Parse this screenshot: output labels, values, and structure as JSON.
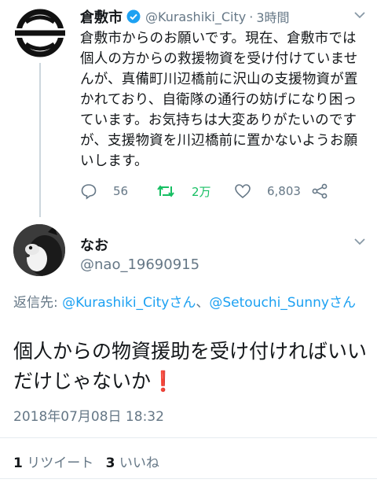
{
  "tweet": {
    "display_name": "倉敷市",
    "handle": "@Kurashiki_City",
    "separator": "·",
    "time": "3時間",
    "text": "倉敷市からのお願いです。現在、倉敷市では個人の方からの救援物資を受け付けていませんが、真備町川辺橋前に沢山の支援物資が置かれており、自衛隊の通行の妨げになり困っています。お気持ちは大変ありがたいのですが、支援物資を川辺橋前に置かないようお願いします。",
    "actions": {
      "reply_count": "56",
      "retweet_count": "2万",
      "like_count": "6,803"
    }
  },
  "reply": {
    "display_name": "なお",
    "handle": "@nao_19690915",
    "reply_to_label": "返信先: ",
    "reply_to_user1": "@Kurashiki_Cityさん",
    "reply_to_sep": "、",
    "reply_to_user2": "@Setouchi_Sunnyさん",
    "text": "個人からの物資援助を受け付ければいいだけじゃないか",
    "emoji": "❗",
    "timestamp": "2018年07月08日 18:32",
    "retweets_count": "1",
    "retweets_label": "リツイート",
    "likes_count": "3",
    "likes_label": "いいね"
  },
  "colors": {
    "accent": "#1da1f2",
    "retweet_green": "#17bf63",
    "muted": "#657786",
    "verified": "#1da1f2",
    "emoji_red": "#e0245e"
  },
  "icons": [
    "city-logo-avatar",
    "verified-badge-icon",
    "chevron-down-icon",
    "reply-icon",
    "retweet-icon",
    "like-icon",
    "share-icon",
    "cat-avatar"
  ]
}
